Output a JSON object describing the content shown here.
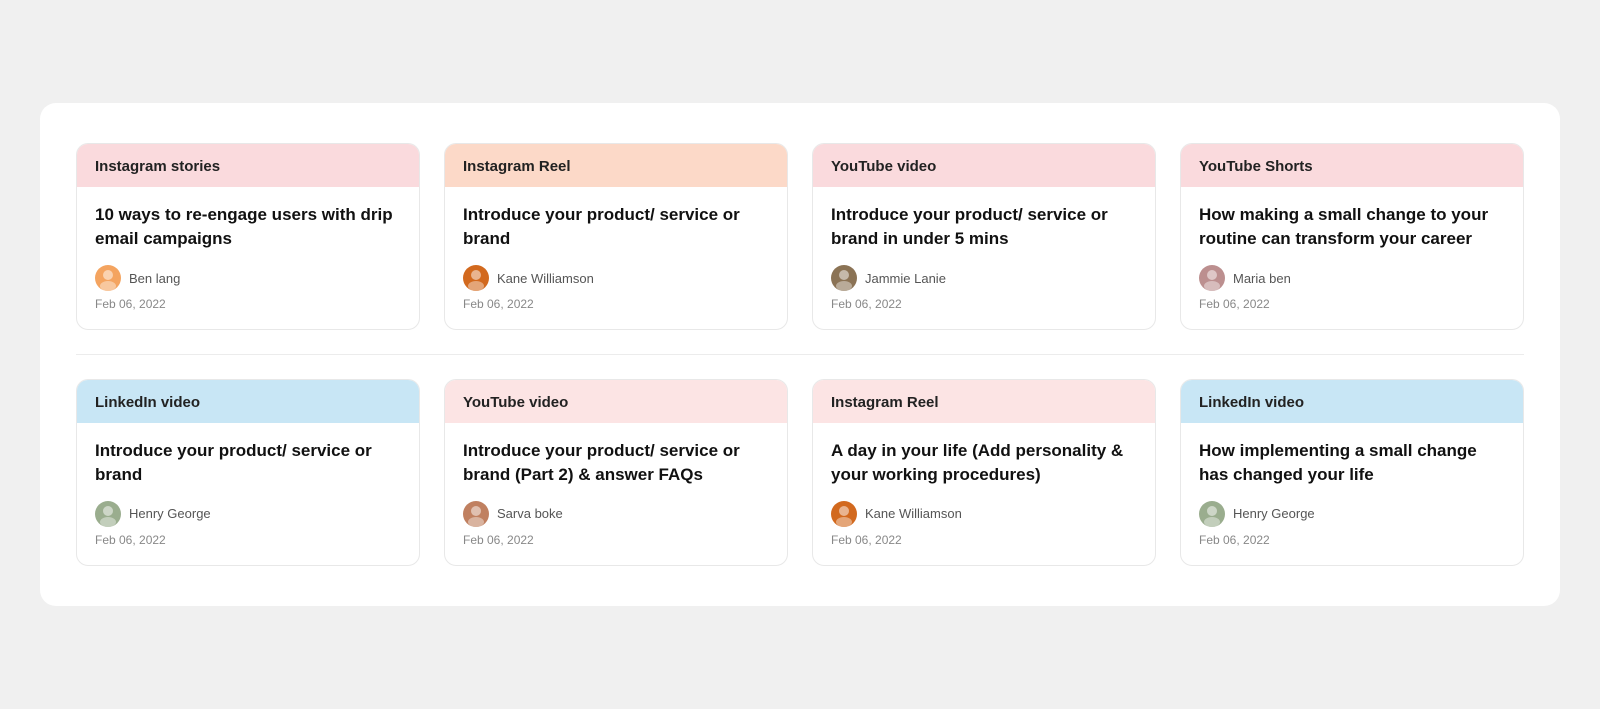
{
  "cards": [
    {
      "id": "card-1",
      "header_label": "Instagram stories",
      "header_class": "pink",
      "title": "10 ways to re-engage users with drip email campaigns",
      "author_name": "Ben lang",
      "author_class": "av-ben",
      "date": "Feb 06, 2022"
    },
    {
      "id": "card-2",
      "header_label": "Instagram Reel",
      "header_class": "salmon",
      "title": "Introduce your product/ service or brand",
      "author_name": "Kane Williamson",
      "author_class": "av-kane",
      "date": "Feb 06, 2022"
    },
    {
      "id": "card-3",
      "header_label": "YouTube video",
      "header_class": "pink",
      "title": "Introduce your product/ service or brand in under 5 mins",
      "author_name": "Jammie Lanie",
      "author_class": "av-jammie",
      "date": "Feb 06, 2022"
    },
    {
      "id": "card-4",
      "header_label": "YouTube Shorts",
      "header_class": "pink",
      "title": "How making a small change to your routine can transform your career",
      "author_name": "Maria ben",
      "author_class": "av-maria",
      "date": "Feb 06, 2022"
    },
    {
      "id": "card-5",
      "header_label": "LinkedIn video",
      "header_class": "blue",
      "title": "Introduce your product/ service or brand",
      "author_name": "Henry George",
      "author_class": "av-henry",
      "date": "Feb 06, 2022"
    },
    {
      "id": "card-6",
      "header_label": "YouTube video",
      "header_class": "light-pink",
      "title": "Introduce your product/ service or brand (Part 2) & answer FAQs",
      "author_name": "Sarva boke",
      "author_class": "av-sarva",
      "date": "Feb 06, 2022"
    },
    {
      "id": "card-7",
      "header_label": "Instagram Reel",
      "header_class": "light-pink",
      "title": "A day in your life (Add personality & your working procedures)",
      "author_name": "Kane Williamson",
      "author_class": "av-kane",
      "date": "Feb 06, 2022"
    },
    {
      "id": "card-8",
      "header_label": "LinkedIn video",
      "header_class": "blue",
      "title": "How implementing a small change has changed your life",
      "author_name": "Henry George",
      "author_class": "av-henry",
      "date": "Feb 06, 2022"
    }
  ]
}
